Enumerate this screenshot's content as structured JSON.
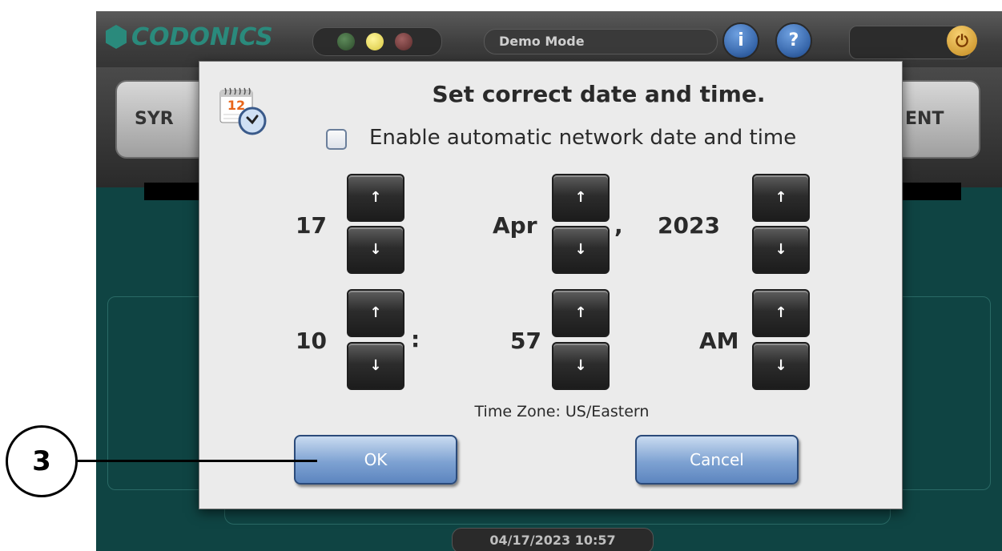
{
  "app": {
    "logo_text": "CODONICS",
    "mode": "Demo Mode",
    "status_time": "04/17/2023 10:57"
  },
  "nav": {
    "left_label": "SYR",
    "right_label": "ENT"
  },
  "header_icons": {
    "info": "i",
    "help": "?",
    "power": "⏻"
  },
  "dialog": {
    "title": "Set correct date and time.",
    "auto_label": "Enable automatic network date and time",
    "auto_checked": false,
    "day": "17",
    "month": "Apr",
    "year": "2023",
    "hour": "10",
    "minute": "57",
    "ampm": "AM",
    "date_sep": ",",
    "time_sep": ":",
    "up_arrow": "↑",
    "down_arrow": "↓",
    "timezone": "Time Zone: US/Eastern",
    "ok": "OK",
    "cancel": "Cancel",
    "calendar_icon_text": "12"
  },
  "callout": {
    "number": "3"
  }
}
